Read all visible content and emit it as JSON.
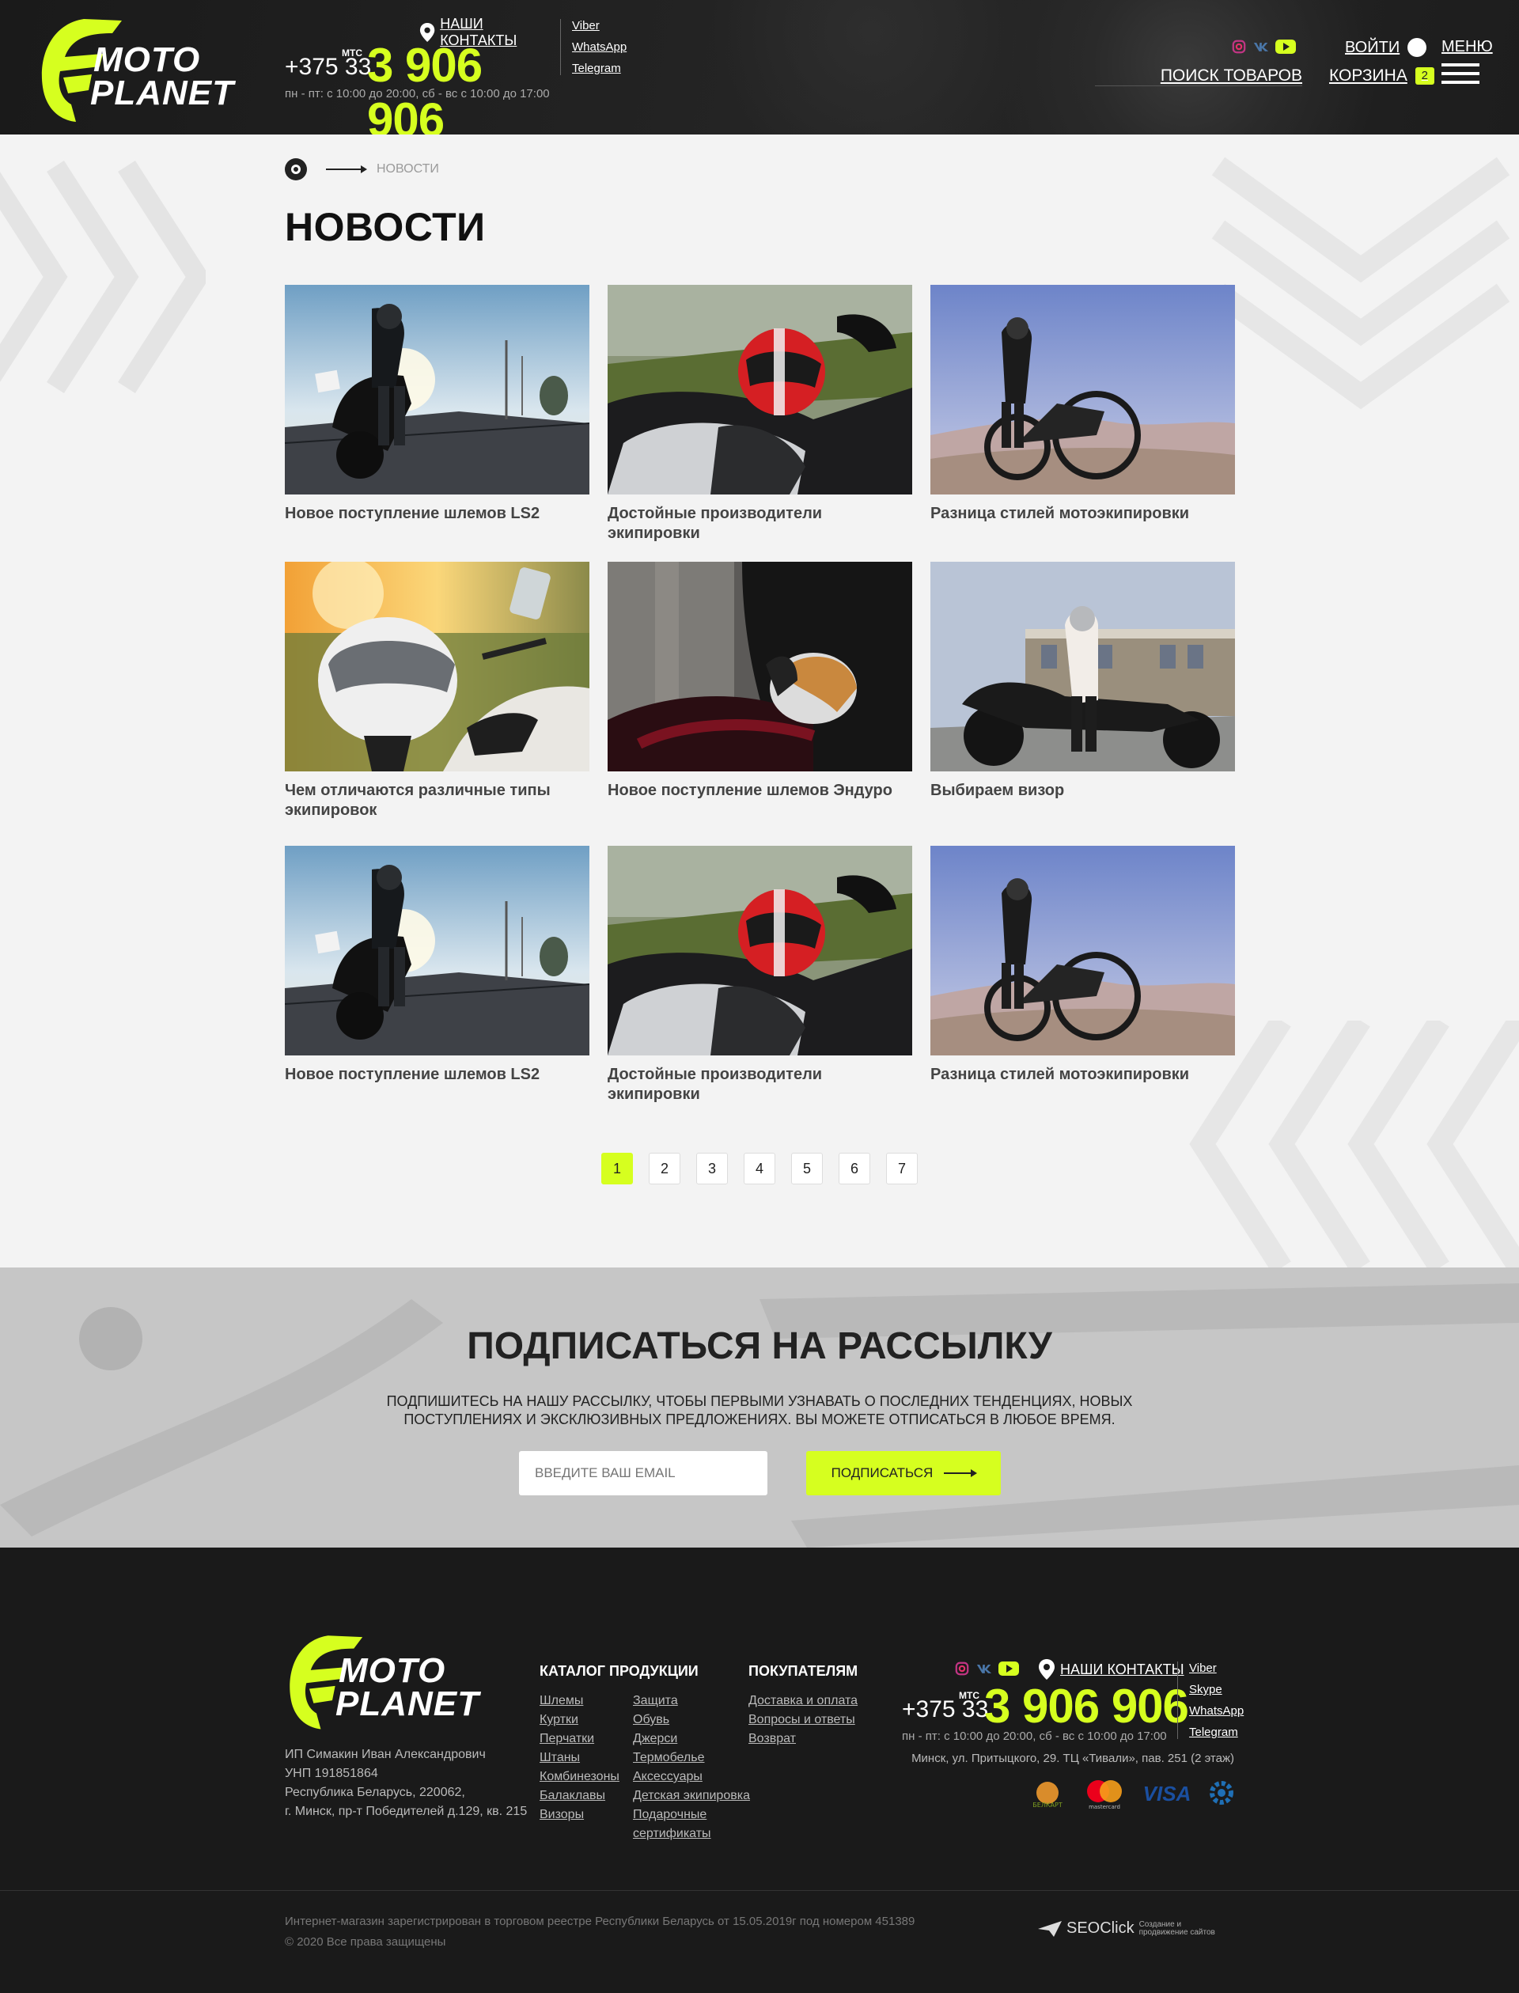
{
  "brand": {
    "line1": "MOTO",
    "line2": "PLANET",
    "accent": "#d6ff1f"
  },
  "header": {
    "contacts_label": "НАШИ КОНТАКТЫ",
    "carrier": "МТС",
    "phone_prefix": "+375 33",
    "phone_main": "3 906 906",
    "hours": "пн - пт: с 10:00 до 20:00,    сб - вс  с 10:00 до 17:00",
    "messengers": [
      "Viber",
      "WhatsApp",
      "Telegram"
    ],
    "socials": [
      "instagram-icon",
      "vk-icon",
      "youtube-icon"
    ],
    "login": "ВОЙТИ",
    "menu": "МЕНЮ",
    "search": "ПОИСК ТОВАРОВ",
    "cart": "КОРЗИНА",
    "cart_count": "2"
  },
  "breadcrumb": {
    "current": "НОВОСТИ"
  },
  "page_title": "НОВОСТИ",
  "news": [
    {
      "title": "Новое поступление шлемов LS2",
      "image": "rider-sunset-road"
    },
    {
      "title": "Достойные производители экипировки",
      "image": "red-helmet-on-bike"
    },
    {
      "title": "Разница стилей мотоэкипировки",
      "image": "rider-with-cruiser"
    },
    {
      "title": "Чем отличаются различные типы экипировок",
      "image": "white-helmet-sunset"
    },
    {
      "title": "Новое поступление шлемов Эндуро",
      "image": "hand-holding-helmet"
    },
    {
      "title": "Выбираем визор",
      "image": "woman-on-motorcycle"
    },
    {
      "title": "Новое поступление шлемов LS2",
      "image": "rider-sunset-road"
    },
    {
      "title": "Достойные производители экипировки",
      "image": "red-helmet-on-bike"
    },
    {
      "title": "Разница стилей мотоэкипировки",
      "image": "rider-with-cruiser"
    }
  ],
  "pagination": {
    "pages": [
      "1",
      "2",
      "3",
      "4",
      "5",
      "6",
      "7"
    ],
    "current": "1"
  },
  "subscribe": {
    "title": "ПОДПИСАТЬСЯ НА РАССЫЛКУ",
    "text": "ПОДПИШИТЕСЬ НА НАШУ РАССЫЛКУ, ЧТОБЫ ПЕРВЫМИ УЗНАВАТЬ О ПОСЛЕДНИХ ТЕНДЕНЦИЯХ, НОВЫХ ПОСТУПЛЕНИЯХ И ЭКСКЛЮЗИВНЫХ ПРЕДЛОЖЕНИЯХ. ВЫ МОЖЕТЕ ОТПИСАТЬСЯ В ЛЮБОЕ ВРЕМЯ.",
    "placeholder": "ВВЕДИТЕ ВАШ EMAIL",
    "button": "ПОДПИСАТЬСЯ"
  },
  "footer": {
    "legal": [
      "ИП Симакин Иван Александрович",
      "УНП 191851864",
      "Республика Беларусь, 220062,",
      "г. Минск, пр-т Победителей д.129, кв. 215"
    ],
    "catalog_title": "КАТАЛОГ ПРОДУКЦИИ",
    "catalog_col1": [
      "Шлемы",
      "Куртки",
      "Перчатки",
      "Штаны",
      "Комбинезоны",
      "Балаклавы",
      "Визоры"
    ],
    "catalog_col2": [
      "Защита",
      "Обувь",
      "Джерси",
      "Термобелье",
      "Аксессуары",
      "Детская экипировка",
      "Подарочные",
      "сертификаты"
    ],
    "buyers_title": "ПОКУПАТЕЛЯМ",
    "buyers": [
      "Доставка и оплата",
      "Вопросы и ответы",
      "Возврат"
    ],
    "contacts_label": "НАШИ КОНТАКТЫ",
    "carrier": "МТС",
    "phone_prefix": "+375 33",
    "phone_main": "3 906 906",
    "hours": "пн - пт: с 10:00 до 20:00,    сб - вс  с 10:00 до 17:00",
    "messengers": [
      "Viber",
      "Skype",
      "WhatsApp",
      "Telegram"
    ],
    "address": "Минск, ул. Притыцкого, 29. ТЦ «Тивали», пав. 251 (2 этаж)",
    "payments": [
      "belkart-icon",
      "mastercard-icon",
      "visa-icon",
      "webpay-icon"
    ],
    "payment_labels": {
      "belkart": "БЕЛКАРТ",
      "mastercard": "mastercard",
      "visa": "VISA"
    },
    "registry": "Интернет-магазин зарегистрирован в торговом реестре Республики Беларусь от 15.05.2019г под номером 451389",
    "copyright": "© 2020 Все права защищены",
    "developer": "SEOClick",
    "developer_tag1": "Создание и",
    "developer_tag2": "продвижение сайтов"
  }
}
